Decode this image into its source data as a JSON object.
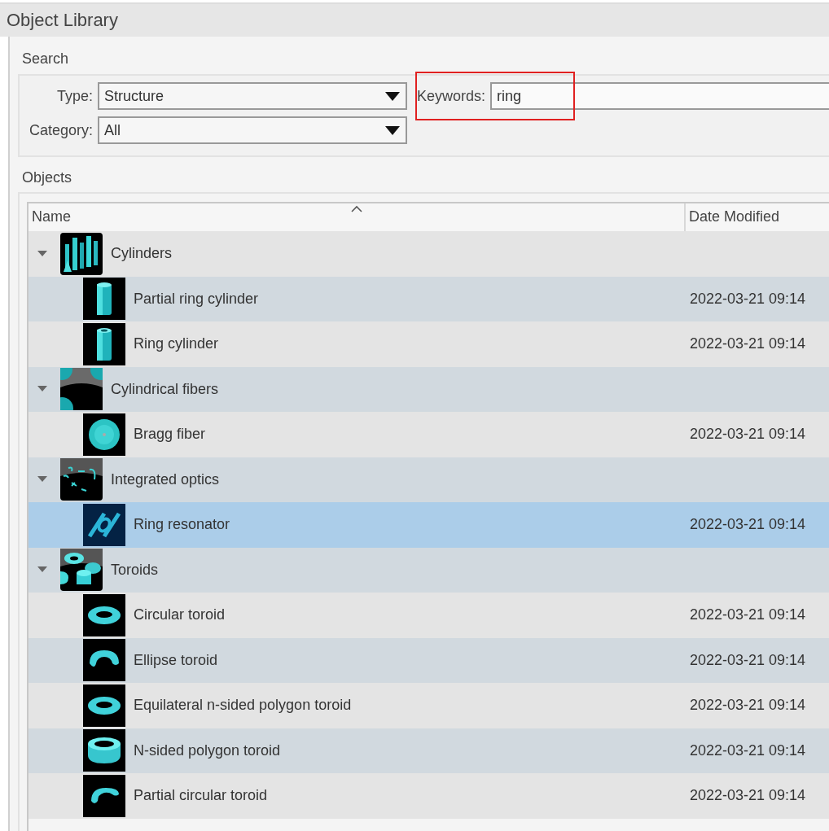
{
  "window": {
    "title": "Object Library"
  },
  "search": {
    "title": "Search",
    "type": {
      "label": "Type:",
      "value": "Structure"
    },
    "category": {
      "label": "Category:",
      "value": "All"
    },
    "keywords": {
      "label": "Keywords:",
      "value": "ring",
      "highlighted": true
    }
  },
  "objects": {
    "title": "Objects",
    "columns": [
      {
        "label": "Name",
        "sorted": true
      },
      {
        "label": "Date Modified",
        "sorted": false
      }
    ],
    "groups": [
      {
        "name": "Cylinders",
        "expanded": true,
        "selected": false,
        "children": [
          {
            "name": "Partial ring cylinder",
            "date": "2022-03-21 09:14",
            "selected": false
          },
          {
            "name": "Ring cylinder",
            "date": "2022-03-21 09:14",
            "selected": false
          }
        ]
      },
      {
        "name": "Cylindrical fibers",
        "expanded": true,
        "selected": false,
        "children": [
          {
            "name": "Bragg fiber",
            "date": "2022-03-21 09:14",
            "selected": false
          }
        ]
      },
      {
        "name": "Integrated optics",
        "expanded": true,
        "selected": false,
        "children": [
          {
            "name": "Ring resonator",
            "date": "2022-03-21 09:14",
            "selected": true
          }
        ]
      },
      {
        "name": "Toroids",
        "expanded": true,
        "selected": false,
        "children": [
          {
            "name": "Circular toroid",
            "date": "2022-03-21 09:14",
            "selected": false
          },
          {
            "name": "Ellipse toroid",
            "date": "2022-03-21 09:14",
            "selected": false
          },
          {
            "name": "Equilateral n-sided polygon toroid",
            "date": "2022-03-21 09:14",
            "selected": false
          },
          {
            "name": "N-sided polygon toroid",
            "date": "2022-03-21 09:14",
            "selected": false
          },
          {
            "name": "Partial circular toroid",
            "date": "2022-03-21 09:14",
            "selected": false
          }
        ]
      }
    ]
  }
}
